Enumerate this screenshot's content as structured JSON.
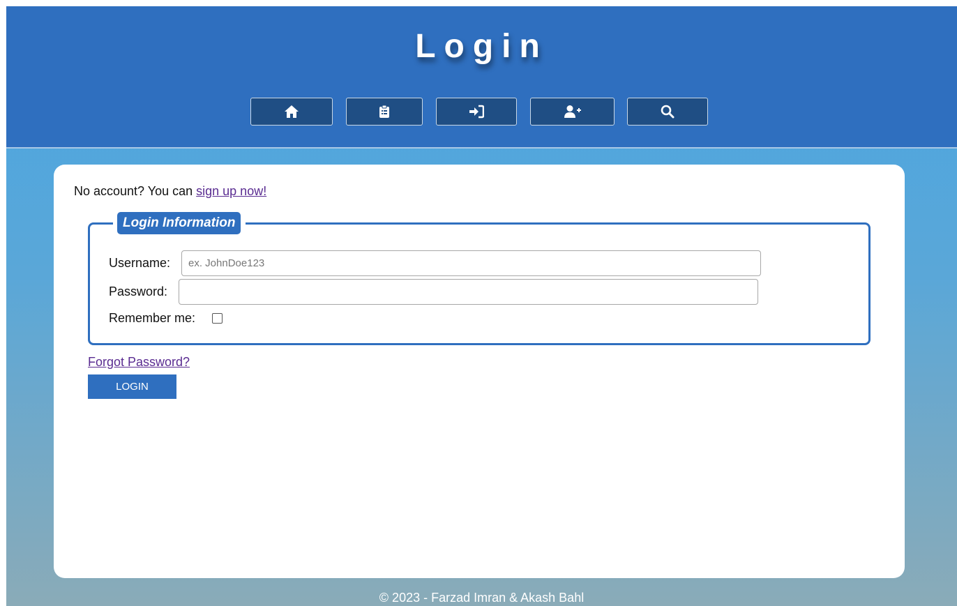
{
  "header": {
    "title": "Login",
    "nav": [
      {
        "icon": "home-icon"
      },
      {
        "icon": "clipboard-list-icon"
      },
      {
        "icon": "sign-in-icon"
      },
      {
        "icon": "user-plus-icon"
      },
      {
        "icon": "search-icon"
      }
    ]
  },
  "main": {
    "signup_prefix": "No account? You can ",
    "signup_link": "sign up now!",
    "legend": "Login Information",
    "username_label": "Username:",
    "username_placeholder": "ex. JohnDoe123",
    "username_value": "",
    "password_label": "Password:",
    "password_value": "",
    "remember_label": "Remember me:",
    "remember_checked": false,
    "forgot_link": "Forgot Password?",
    "login_button": "LOGIN"
  },
  "footer": {
    "text": "© 2023 - Farzad Imran & Akash Bahl"
  },
  "colors": {
    "header_bg": "#2f6fbf",
    "nav_button_bg": "#1f4e84",
    "accent": "#2f6fbf",
    "link": "#5a2c91"
  }
}
